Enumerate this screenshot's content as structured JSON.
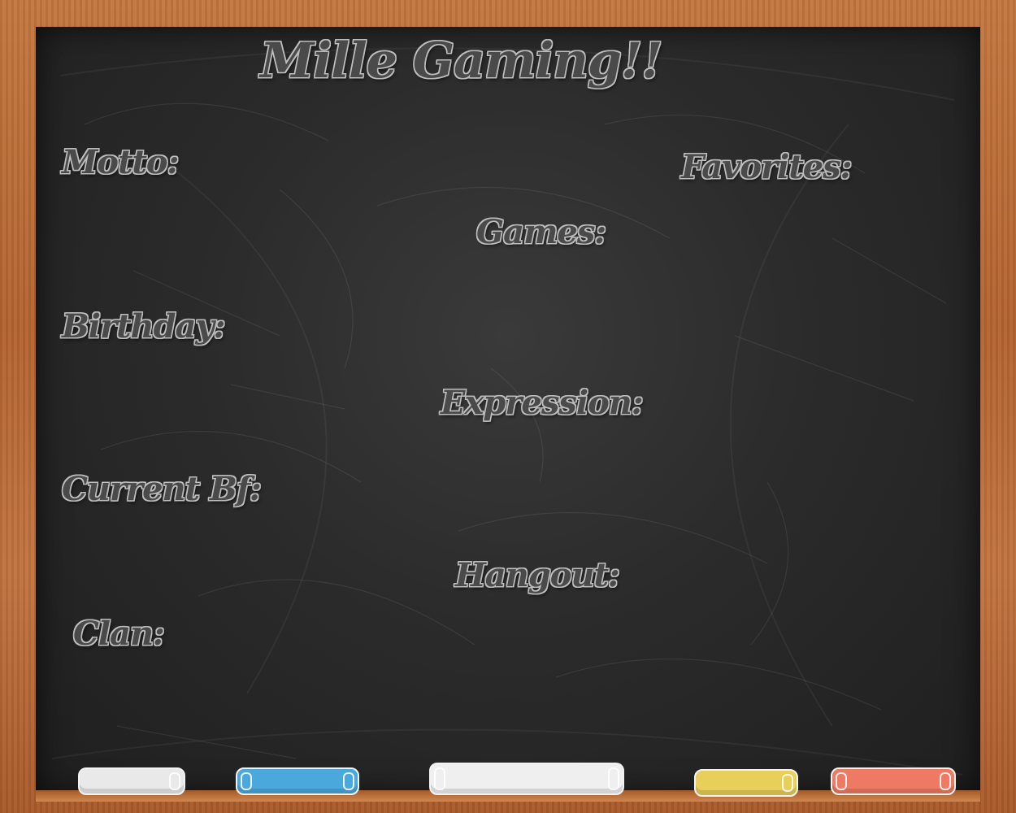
{
  "title": "Mille Gaming!!",
  "fields": {
    "motto": "Motto:",
    "favorites": "Favorites:",
    "games": "Games:",
    "birthday": "Birthday:",
    "expression": "Expression:",
    "current_bf": "Current Bf:",
    "hangout": "Hangout:",
    "clan": "Clan:"
  },
  "chalk_colors": {
    "white": "#e9e9e9",
    "blue": "#4aa8dc",
    "big_white": "#efefef",
    "yellow": "#e8cf5a",
    "red": "#ee7a63"
  },
  "colors": {
    "board": "#2b2b2b",
    "frame": "#b86a3a",
    "text_fill": "#4a4a4a",
    "text_outline": "#bdbdbd"
  }
}
